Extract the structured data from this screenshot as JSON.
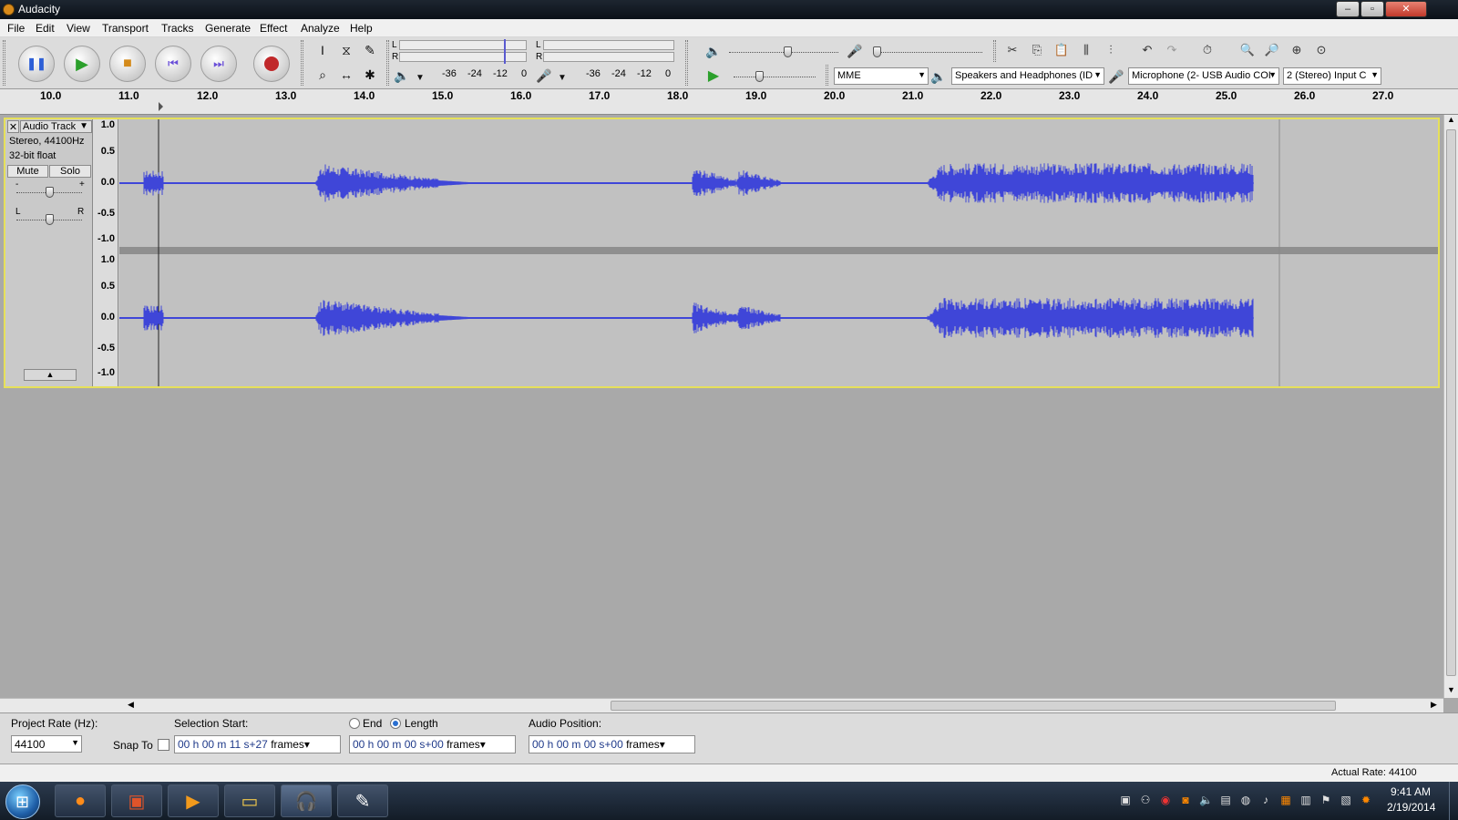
{
  "window": {
    "title": "Audacity",
    "buttons": [
      "–",
      "▫",
      "✕"
    ]
  },
  "menu": [
    "File",
    "Edit",
    "View",
    "Transport",
    "Tracks",
    "Generate",
    "Effect",
    "Analyze",
    "Help"
  ],
  "meters": {
    "left": "L",
    "right": "R",
    "scale": [
      "-36",
      "-24",
      "-12",
      "0"
    ]
  },
  "devices": {
    "host": "MME",
    "output": "Speakers and Headphones (ID",
    "input": "Microphone (2- USB Audio COI",
    "channels": "2 (Stereo) Input C"
  },
  "ruler": {
    "ticks": [
      "10.0",
      "11.0",
      "12.0",
      "13.0",
      "14.0",
      "15.0",
      "16.0",
      "17.0",
      "18.0",
      "19.0",
      "20.0",
      "21.0",
      "22.0",
      "23.0",
      "24.0",
      "25.0",
      "26.0",
      "27.0"
    ]
  },
  "track": {
    "name": "Audio Track",
    "info1": "Stereo, 44100Hz",
    "info2": "32-bit float",
    "mute": "Mute",
    "solo": "Solo",
    "gain_minus": "-",
    "gain_plus": "+",
    "pan_left": "L",
    "pan_right": "R",
    "scale": [
      "1.0",
      "0.5",
      "0.0",
      "-0.5",
      "-1.0"
    ]
  },
  "selection": {
    "project_rate_label": "Project Rate (Hz):",
    "project_rate": "44100",
    "snap_label": "Snap To",
    "start_label": "Selection Start:",
    "end_label": "End",
    "length_label": "Length",
    "position_label": "Audio Position:",
    "start_value": "00 h 00 m 11 s+27",
    "length_value": "00 h 00 m 00 s+00",
    "position_value": "00 h 00 m 00 s+00",
    "units": "frames"
  },
  "status": {
    "actual_rate": "Actual Rate: 44100"
  },
  "clock": {
    "time": "9:41 AM",
    "date": "2/19/2014"
  },
  "colors": {
    "waveform": "#3f46d8",
    "track_border": "#e6e05a"
  }
}
